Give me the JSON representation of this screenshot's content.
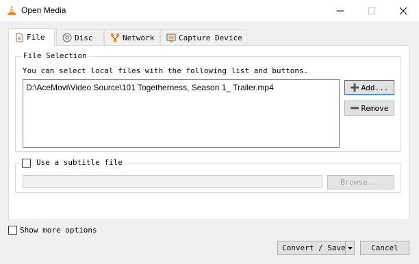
{
  "window": {
    "title": "Open Media"
  },
  "tabs": [
    {
      "label": "File",
      "icon": "file-icon"
    },
    {
      "label": "Disc",
      "icon": "disc-icon"
    },
    {
      "label": "Network",
      "icon": "network-icon"
    },
    {
      "label": "Capture Device",
      "icon": "capture-device-icon"
    }
  ],
  "file_selection": {
    "title": "File Selection",
    "hint": "You can select local files with the following list and buttons.",
    "files": [
      "D:\\AceMovi\\Video Source\\101 Togetherness, Season 1_ Trailer.mp4"
    ],
    "add_label": "Add...",
    "remove_label": "Remove"
  },
  "subtitle": {
    "label": "Use a subtitle file",
    "checked": false,
    "value": "",
    "browse_label": "Browse..."
  },
  "show_more": {
    "label": "Show more options",
    "checked": false
  },
  "footer": {
    "convert_label": "Convert / Save",
    "cancel_label": "Cancel"
  },
  "colors": {
    "accent_border": "#0078d7",
    "vlc_orange": "#ff8800"
  }
}
